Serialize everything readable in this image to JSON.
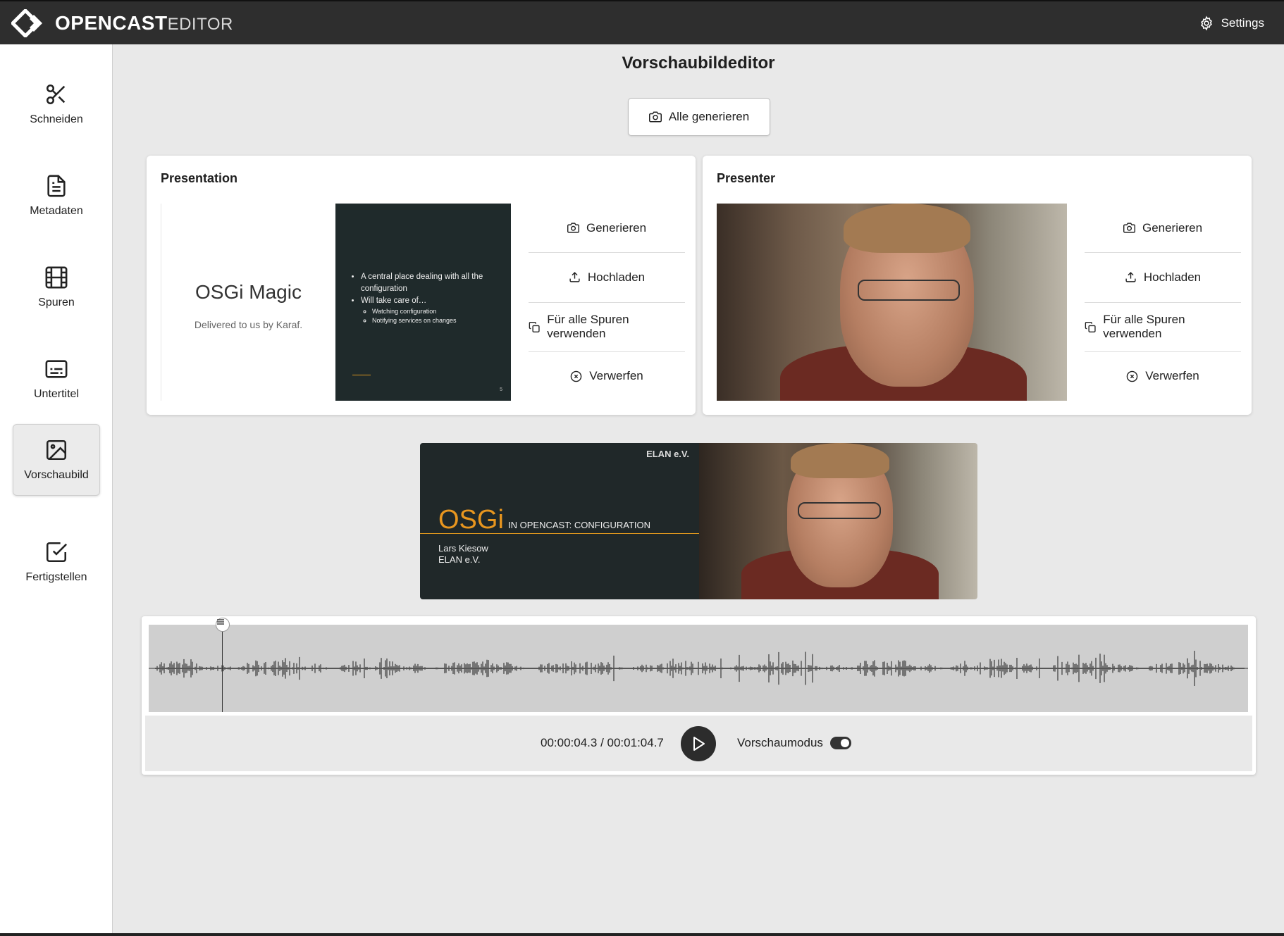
{
  "app": {
    "logo_bold": "OPENCAST",
    "logo_light": "EDITOR",
    "settings_label": "Settings"
  },
  "sidebar": {
    "items": [
      {
        "label": "Schneiden",
        "icon": "scissors-icon"
      },
      {
        "label": "Metadaten",
        "icon": "document-icon"
      },
      {
        "label": "Spuren",
        "icon": "film-icon"
      },
      {
        "label": "Untertitel",
        "icon": "subtitles-icon"
      },
      {
        "label": "Vorschaubild",
        "icon": "image-icon",
        "active": true
      },
      {
        "label": "Fertigstellen",
        "icon": "checkbox-icon"
      }
    ]
  },
  "main": {
    "title": "Vorschaubildeditor",
    "generate_all_label": "Alle generieren"
  },
  "cards": [
    {
      "title": "Presentation",
      "slide": {
        "title": "OSGi Magic",
        "subtitle": "Delivered to us by Karaf.",
        "bullets": [
          "A central place dealing with all the configuration",
          "Will take care of…"
        ],
        "sub_bullets": [
          "Watching configuration",
          "Notifying services on changes"
        ],
        "page": "5"
      },
      "actions": {
        "generate": "Generieren",
        "upload": "Hochladen",
        "use_for_all": "Für alle Spuren verwenden",
        "discard": "Verwerfen"
      }
    },
    {
      "title": "Presenter",
      "actions": {
        "generate": "Generieren",
        "upload": "Hochladen",
        "use_for_all": "Für alle Spuren verwenden",
        "discard": "Verwerfen"
      }
    }
  ],
  "preview": {
    "org_logo": "ELAN e.V.",
    "title_big": "OSGi",
    "title_small": "IN OPENCAST: CONFIGURATION",
    "author": "Lars Kiesow",
    "org": "ELAN e.V."
  },
  "player": {
    "time_display": "00:00:04.3 / 00:01:04.7",
    "preview_mode_label": "Vorschaumodus",
    "preview_mode_on": true
  },
  "colors": {
    "header_bg": "#2e2e2e",
    "accent_orange": "#e8961f",
    "slide_bg": "#1f2a2b"
  }
}
